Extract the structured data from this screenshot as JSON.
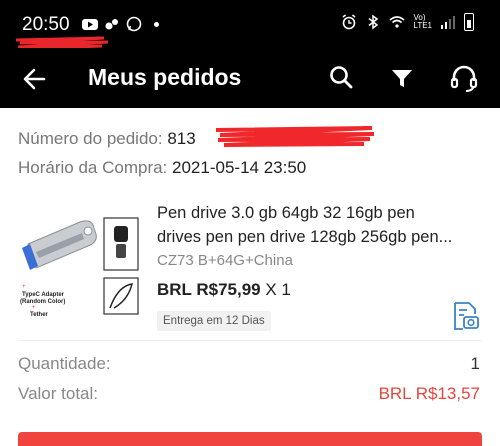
{
  "status_bar": {
    "time": "20:50",
    "network_label": "LTE1",
    "volte_label": "Vo)"
  },
  "header": {
    "title": "Meus pedidos",
    "icons": [
      "back-arrow-icon",
      "search-icon",
      "filter-icon",
      "headset-icon"
    ]
  },
  "order": {
    "number_label": "Número do pedido:",
    "number_value": "813",
    "purchase_time_label": "Horário da Compra:",
    "purchase_time_value": "2021-05-14 23:50"
  },
  "product": {
    "title_line1": "Pen drive 3.0 gb 64gb 32 16gb pen",
    "title_line2": "drives pen pen drive 128gb 256gb pen...",
    "variant": "CZ73 B+64G+China",
    "price": "BRL R$75,99",
    "quantity_text": "X 1",
    "delivery_badge": "Entrega em 12 Dias",
    "image_caption_line1": "TypeC Adapter",
    "image_caption_line2": "(Random Color)",
    "image_caption_line3": "Tether",
    "image_plus": "+"
  },
  "summary": {
    "quantity_label": "Quantidade:",
    "quantity_value": "1",
    "total_label": "Valor total:",
    "total_value": "BRL R$13,57"
  },
  "colors": {
    "header_bg": "#000000",
    "accent_red": "#e5463d",
    "tracking_blue": "#3b82c4"
  }
}
